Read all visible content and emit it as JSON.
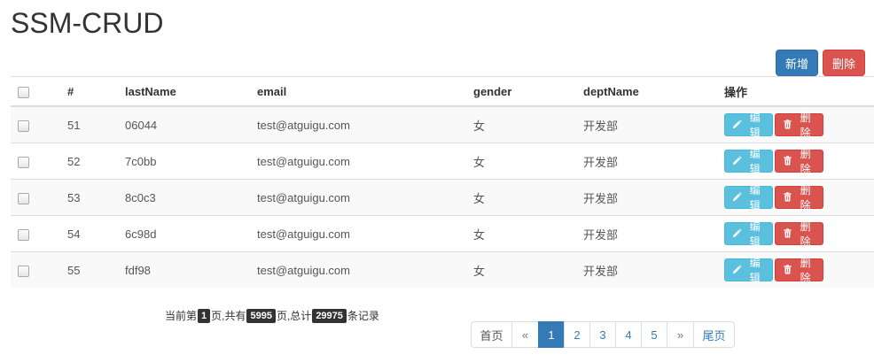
{
  "title": "SSM-CRUD",
  "toolbar": {
    "add_label": "新增",
    "delete_label": "删除"
  },
  "table": {
    "headers": {
      "id": "#",
      "lastName": "lastName",
      "email": "email",
      "gender": "gender",
      "deptName": "deptName",
      "ops": "操作"
    },
    "rows": [
      {
        "id": "51",
        "lastName": "06044",
        "email": "test@atguigu.com",
        "gender": "女",
        "deptName": "开发部"
      },
      {
        "id": "52",
        "lastName": "7c0bb",
        "email": "test@atguigu.com",
        "gender": "女",
        "deptName": "开发部"
      },
      {
        "id": "53",
        "lastName": "8c0c3",
        "email": "test@atguigu.com",
        "gender": "女",
        "deptName": "开发部"
      },
      {
        "id": "54",
        "lastName": "6c98d",
        "email": "test@atguigu.com",
        "gender": "女",
        "deptName": "开发部"
      },
      {
        "id": "55",
        "lastName": "fdf98",
        "email": "test@atguigu.com",
        "gender": "女",
        "deptName": "开发部"
      }
    ],
    "edit_label": "编辑",
    "row_delete_label": "删除"
  },
  "page_info": {
    "prefix": "当前第",
    "current": "1",
    "mid1": "页,共有",
    "total_pages": "5995",
    "mid2": "页,总计",
    "total_records": "29975",
    "suffix": "条记录"
  },
  "pagination": {
    "first": "首页",
    "prev": "«",
    "pages": [
      "1",
      "2",
      "3",
      "4",
      "5"
    ],
    "next": "»",
    "last": "尾页",
    "active": "1"
  }
}
